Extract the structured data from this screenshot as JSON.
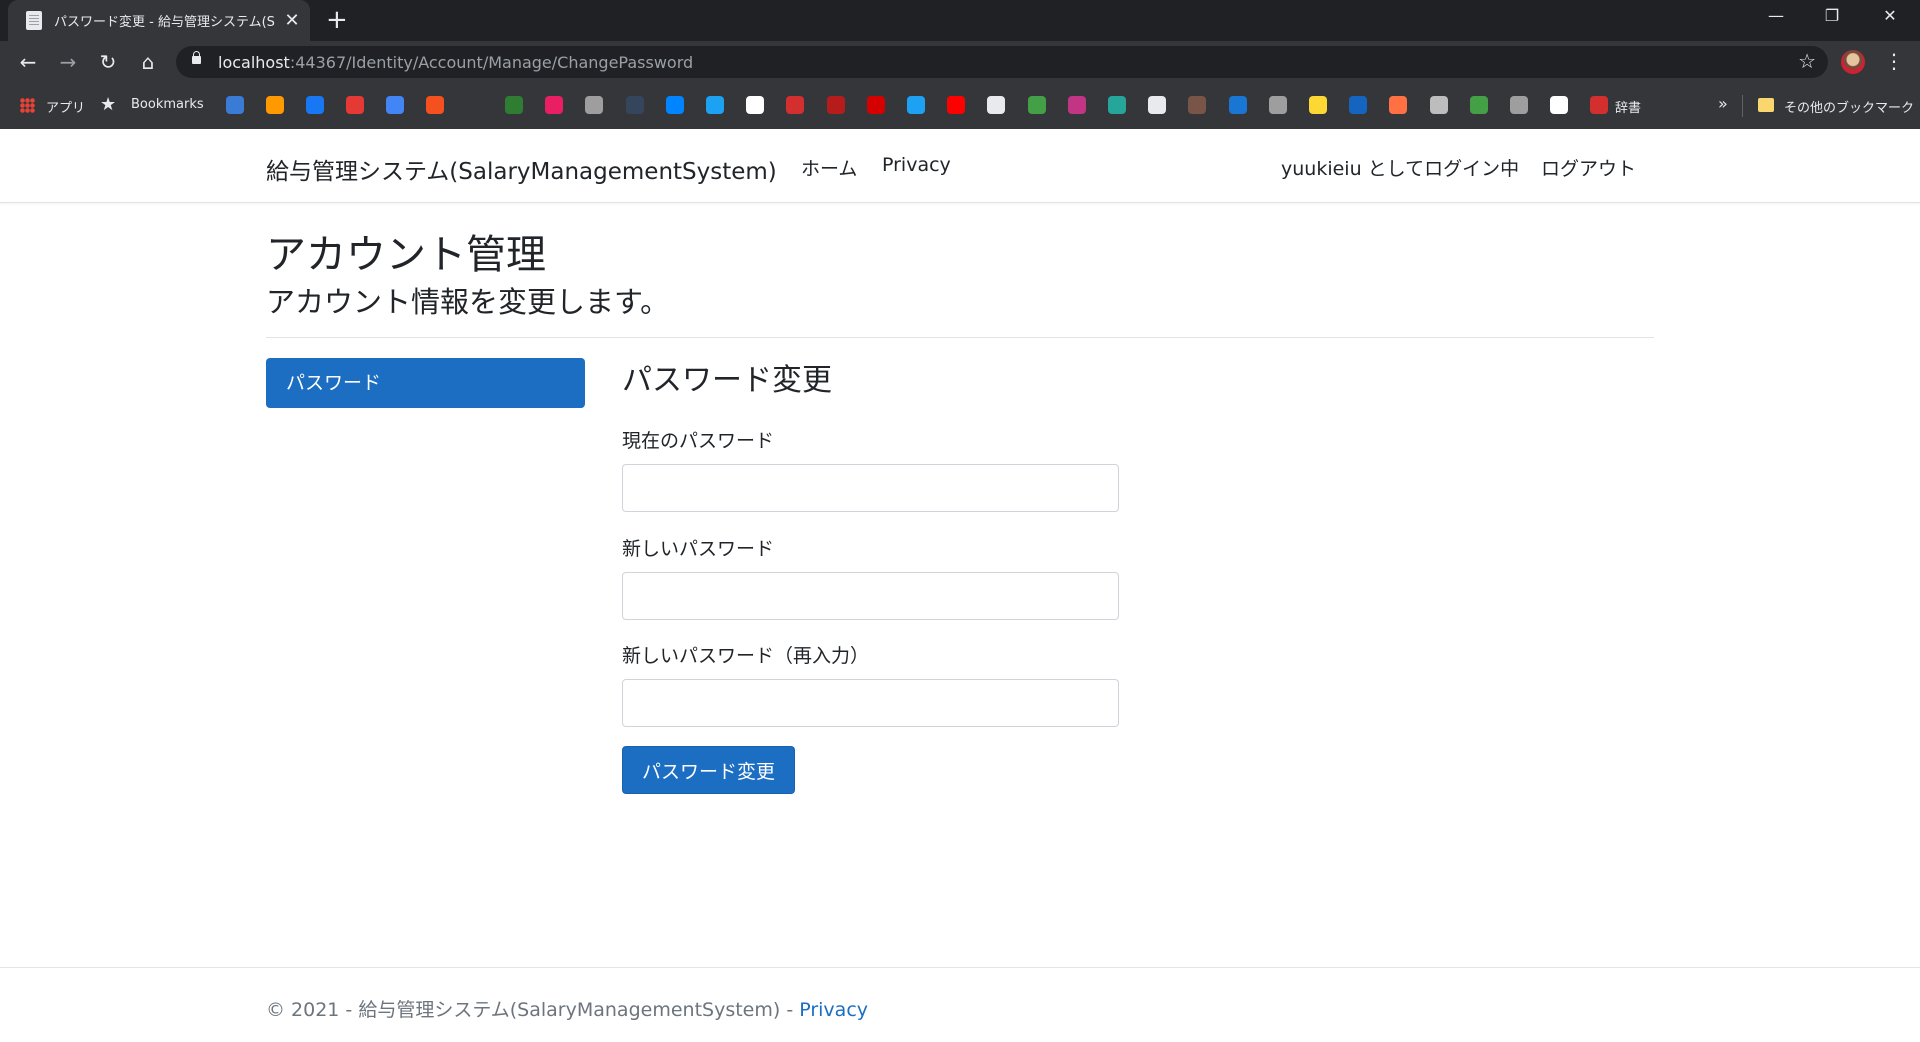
{
  "browser": {
    "tab_title": "パスワード変更 - 給与管理システム(S",
    "url_host": "localhost",
    "url_rest": ":44367/Identity/Account/Manage/ChangePassword",
    "bookmarks": {
      "apps_label": "アプリ",
      "bookmarks_label": "Bookmarks",
      "dict_label": "辞書",
      "other_label": "その他のブックマーク"
    },
    "bookmark_icon_colors": [
      "#3a7bd5",
      "#ff9900",
      "#1877f2",
      "#e53935",
      "#4285f4",
      "#f4511e",
      "#2e7d32",
      "#e91e63",
      "#9e9e9e",
      "#35465c",
      "#0084ff",
      "#1da1f2",
      "#ffffff",
      "#d32f2f",
      "#b71c1c",
      "#d50000",
      "#1da1f2",
      "#ff0000",
      "#e8eaed",
      "#43a047",
      "#c13584",
      "#26a69a",
      "#e8eaed",
      "#795548",
      "#1976d2",
      "#9e9e9e",
      "#fdd835",
      "#1565c0",
      "#ff7043",
      "#bdbdbd",
      "#43a047",
      "#9e9e9e",
      "#ffffff",
      "#d32f2f"
    ]
  },
  "navbar": {
    "brand": "給与管理システム(SalaryManagementSystem)",
    "home": "ホーム",
    "privacy": "Privacy",
    "user_status": "yuukieiu としてログイン中",
    "logout": "ログアウト"
  },
  "page": {
    "title": "アカウント管理",
    "subtitle": "アカウント情報を変更します。"
  },
  "sidebar": {
    "active_item": "パスワード"
  },
  "form": {
    "heading": "パスワード変更",
    "current_password_label": "現在のパスワード",
    "current_password_value": "",
    "new_password_label": "新しいパスワード",
    "new_password_value": "",
    "confirm_password_label": "新しいパスワード（再入力）",
    "confirm_password_value": "",
    "submit_label": "パスワード変更"
  },
  "footer": {
    "copyright": "© 2021 - 給与管理システム(SalaryManagementSystem) - ",
    "privacy_link": "Privacy"
  },
  "colors": {
    "primary": "#1b6ec2",
    "chrome_dark": "#202124",
    "chrome_toolbar": "#35363a"
  }
}
